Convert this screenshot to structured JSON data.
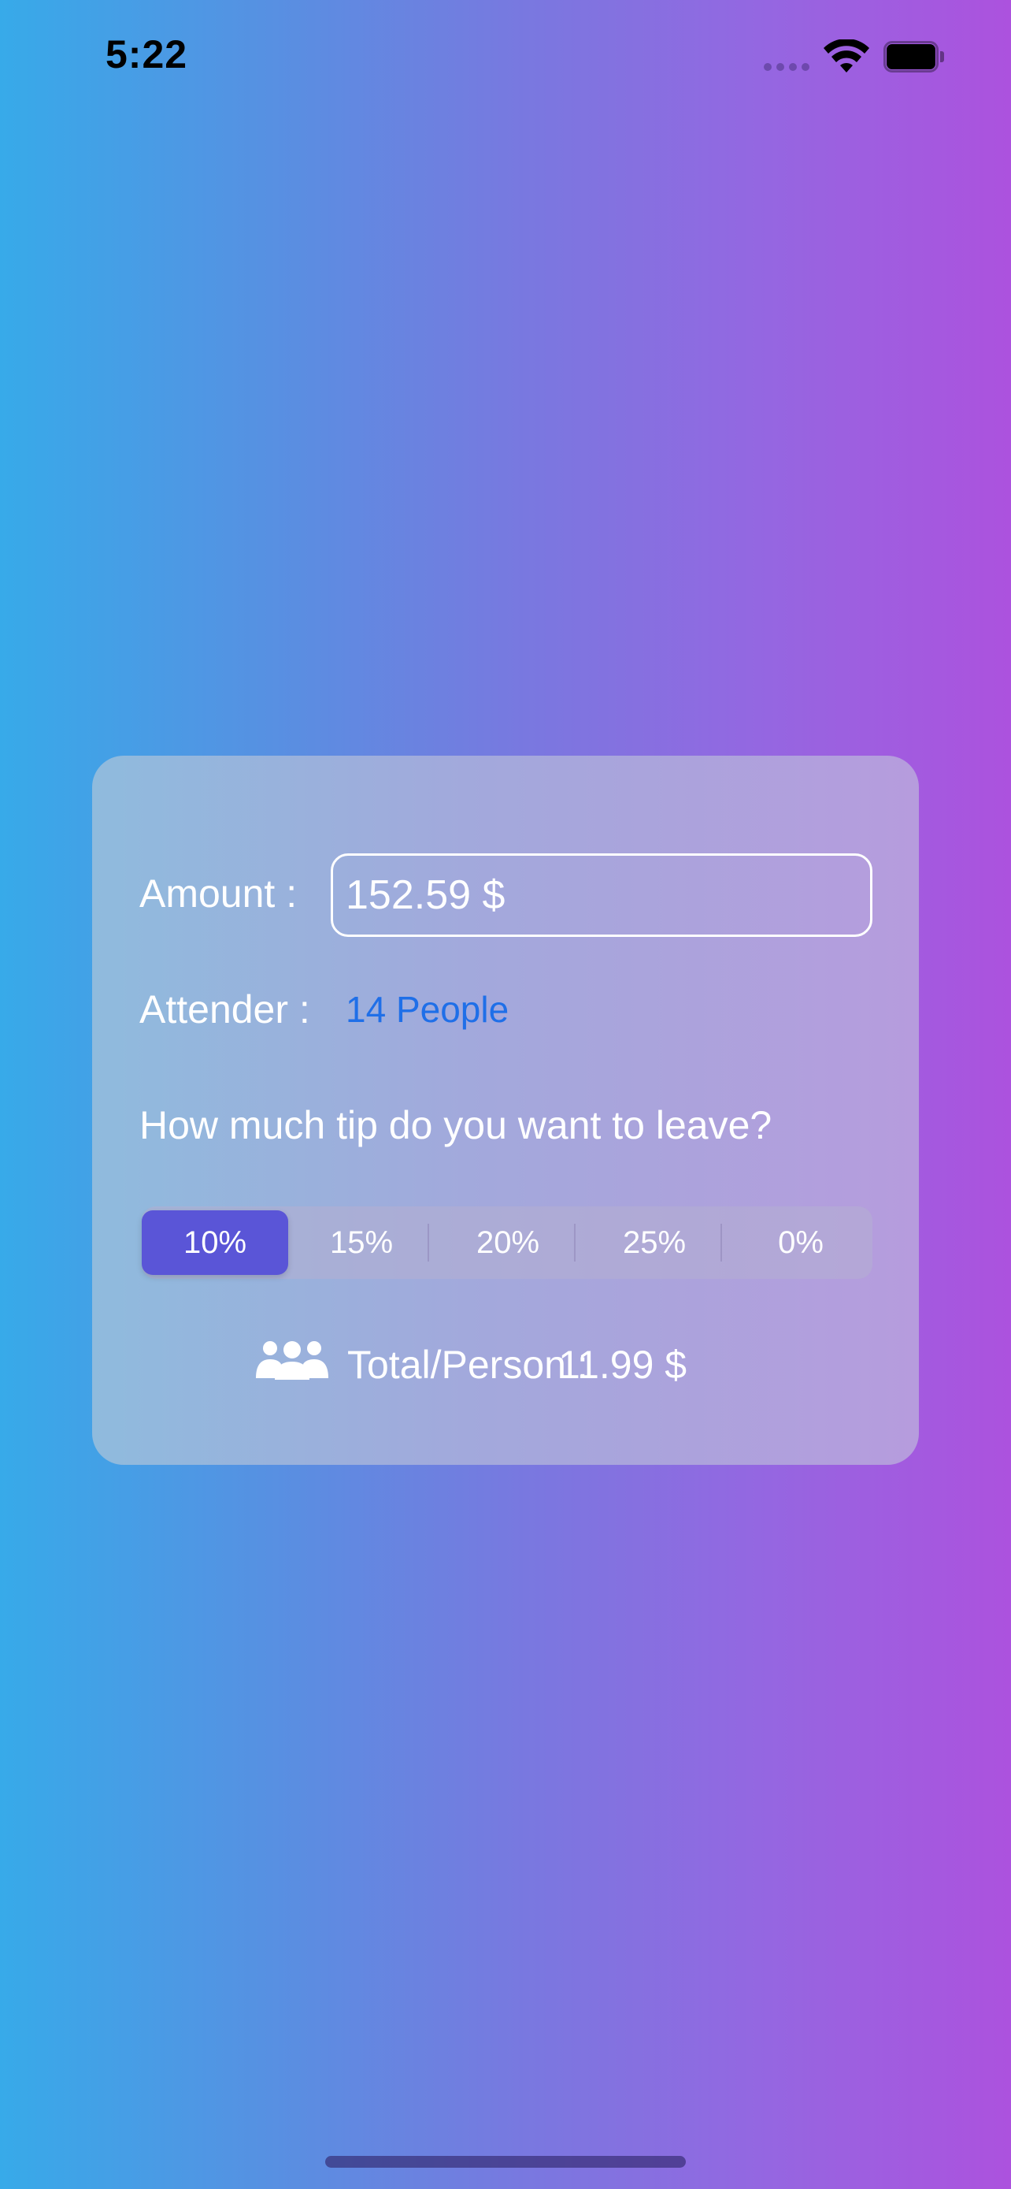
{
  "status_bar": {
    "time": "5:22"
  },
  "form": {
    "amount_label": "Amount :",
    "amount_value": "152.59 $",
    "attender_label": "Attender :",
    "attender_value": "14 People",
    "tip_question": "How much tip do you want to leave?",
    "tip_options": [
      "10%",
      "15%",
      "20%",
      "25%",
      "0%"
    ],
    "selected_tip": "10%",
    "total_label": "Total/Person :",
    "total_value": "11.99 $"
  },
  "colors": {
    "gradient_start": "#37aae9",
    "gradient_end": "#ac52de",
    "selected_segment": "#5a55d7",
    "link_blue": "#1f6fe8"
  },
  "icons": {
    "total": "people-group-icon",
    "wifi": "wifi-icon",
    "battery": "battery-icon",
    "signal": "cellular-signal-icon"
  }
}
